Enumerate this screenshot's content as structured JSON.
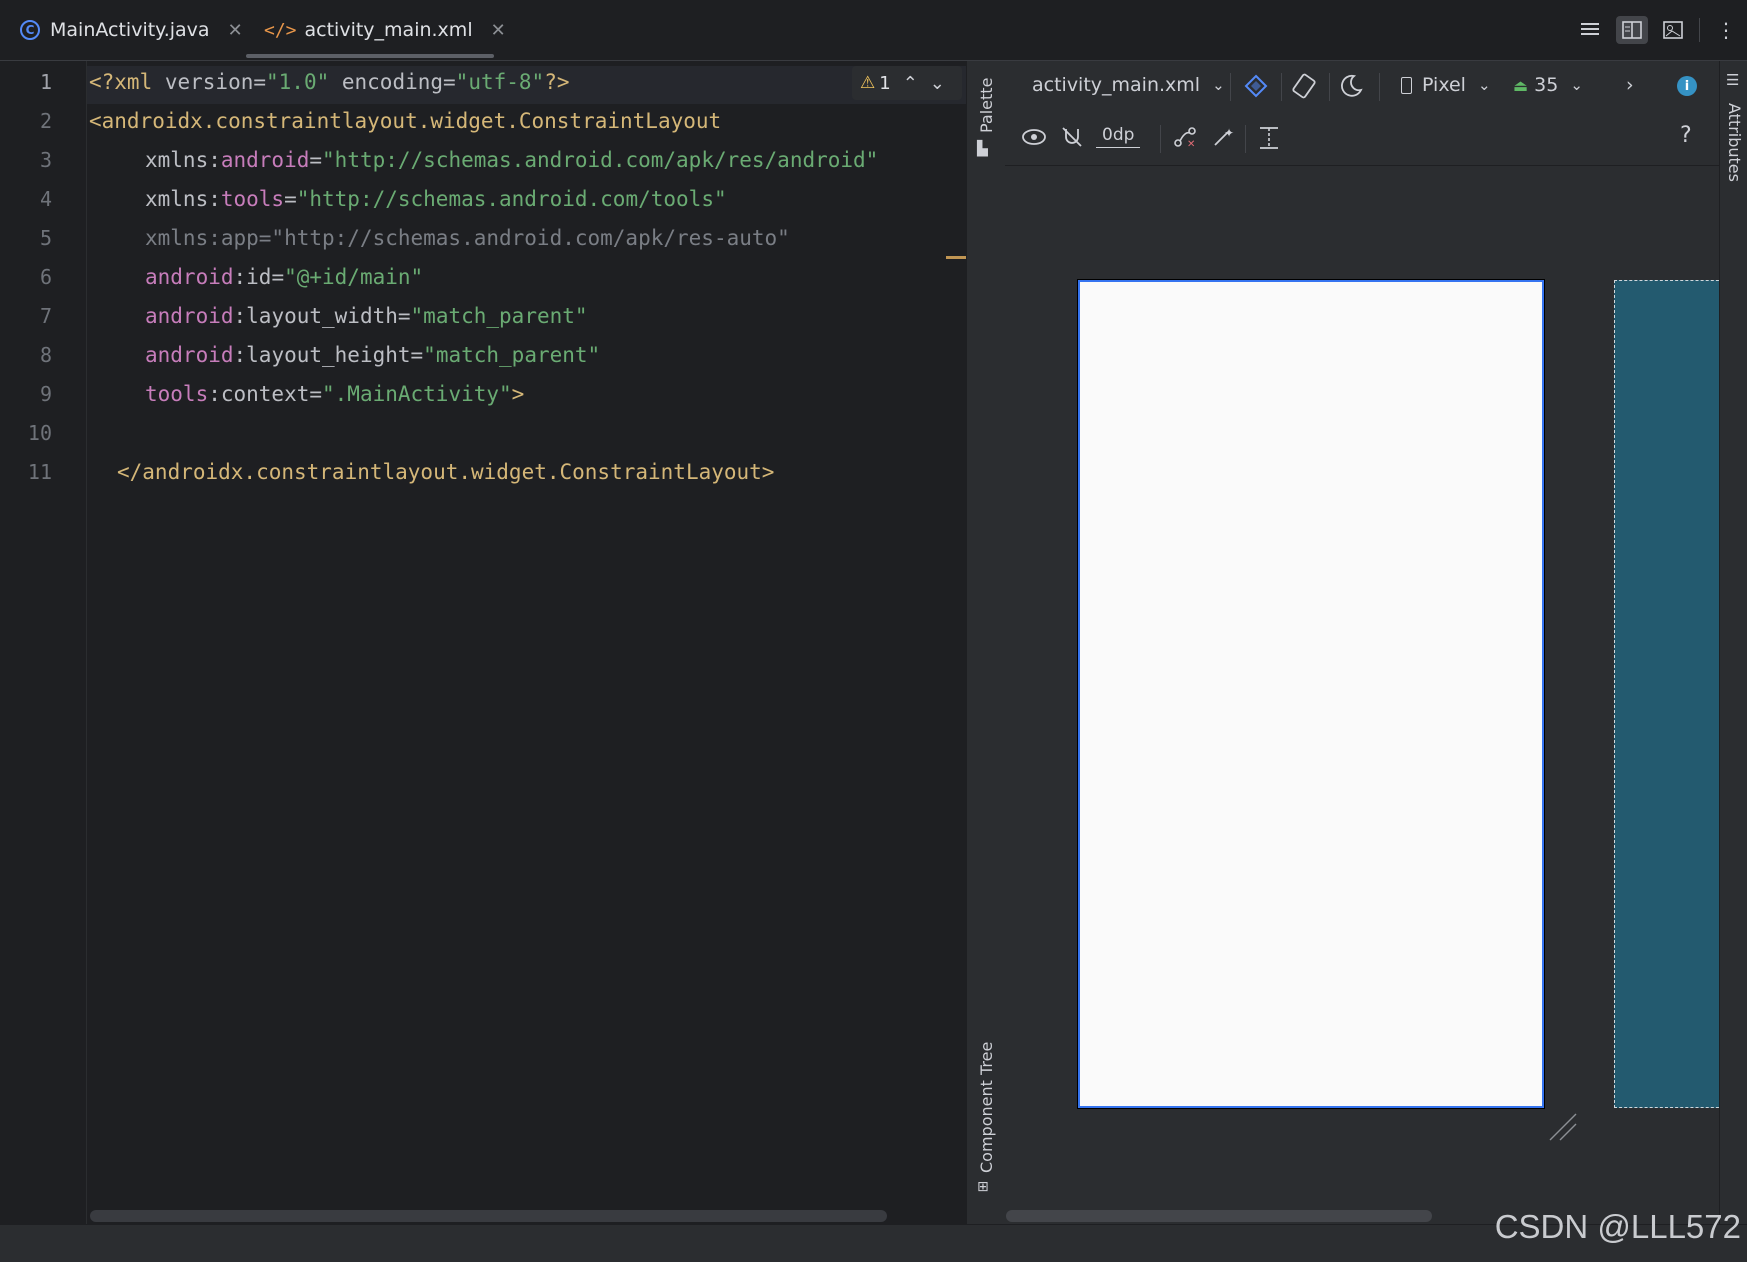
{
  "tabs": [
    {
      "label": "MainActivity.java",
      "icon": "java-class-icon",
      "icon_glyph": "C"
    },
    {
      "label": "activity_main.xml",
      "icon": "xml-file-icon",
      "icon_glyph": "</>",
      "active": true
    }
  ],
  "editor": {
    "line_numbers": [
      "1",
      "2",
      "3",
      "4",
      "5",
      "6",
      "7",
      "8",
      "9",
      "10",
      "11"
    ],
    "warning_count": "1",
    "lines": {
      "l1": {
        "a": "<?xml ",
        "b": "version=",
        "c": "\"1.0\"",
        "d": " encoding=",
        "e": "\"utf-8\"",
        "f": "?>"
      },
      "l2": {
        "a": "<androidx.constraintlayout.widget.ConstraintLayout"
      },
      "l3": {
        "a": "xmlns:",
        "b": "android",
        "c": "=",
        "d": "\"http://schemas.android.com/apk/res/android\""
      },
      "l4": {
        "a": "xmlns:",
        "b": "tools",
        "c": "=",
        "d": "\"http://schemas.android.com/tools\""
      },
      "l5": {
        "a": "xmlns:app=\"http://schemas.android.com/apk/res-auto\""
      },
      "l6": {
        "a": "android",
        "b": ":id=",
        "c": "\"@+id/main\""
      },
      "l7": {
        "a": "android",
        "b": ":layout_width=",
        "c": "\"match_parent\""
      },
      "l8": {
        "a": "android",
        "b": ":layout_height=",
        "c": "\"match_parent\""
      },
      "l9": {
        "a": "tools",
        "b": ":context=",
        "c": "\".MainActivity\"",
        "d": ">"
      },
      "l11": {
        "a": "</androidx.constraintlayout.widget.ConstraintLayout>"
      }
    }
  },
  "side_panels": {
    "palette": "Palette",
    "component_tree": "Component Tree",
    "attributes": "Attributes"
  },
  "design_toolbar": {
    "file_select": "activity_main.xml",
    "device": "Pixel",
    "api_level": "35",
    "margin": "0dp",
    "help": "?"
  },
  "colors": {
    "accent": "#3574f0",
    "blueprint": "#235a6f",
    "info": "#3592c4"
  },
  "watermark": "CSDN @LLL572"
}
